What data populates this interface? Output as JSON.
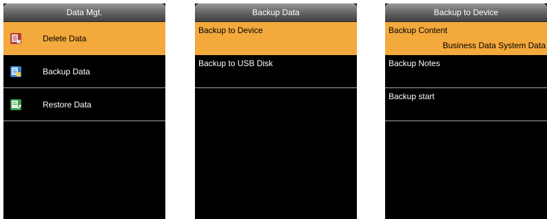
{
  "screens": [
    {
      "title": "Data Mgt.",
      "items": [
        {
          "label": "Delete Data",
          "icon": "delete-data-icon",
          "selected": true
        },
        {
          "label": "Backup Data",
          "icon": "backup-data-icon",
          "selected": false
        },
        {
          "label": "Restore Data",
          "icon": "restore-data-icon",
          "selected": false
        }
      ]
    },
    {
      "title": "Backup Data",
      "items": [
        {
          "label": "Backup to Device",
          "selected": true
        },
        {
          "label": "Backup to USB Disk",
          "selected": false
        }
      ]
    },
    {
      "title": "Backup to Device",
      "items": [
        {
          "label": "Backup Content",
          "value": "Business Data System Data",
          "selected": true
        },
        {
          "label": "Backup Notes",
          "selected": false
        },
        {
          "label": "Backup start",
          "selected": false
        }
      ]
    }
  ],
  "colors": {
    "highlight": "#f3a93c",
    "screen_background": "#000000",
    "divider": "#a8a8a8"
  }
}
